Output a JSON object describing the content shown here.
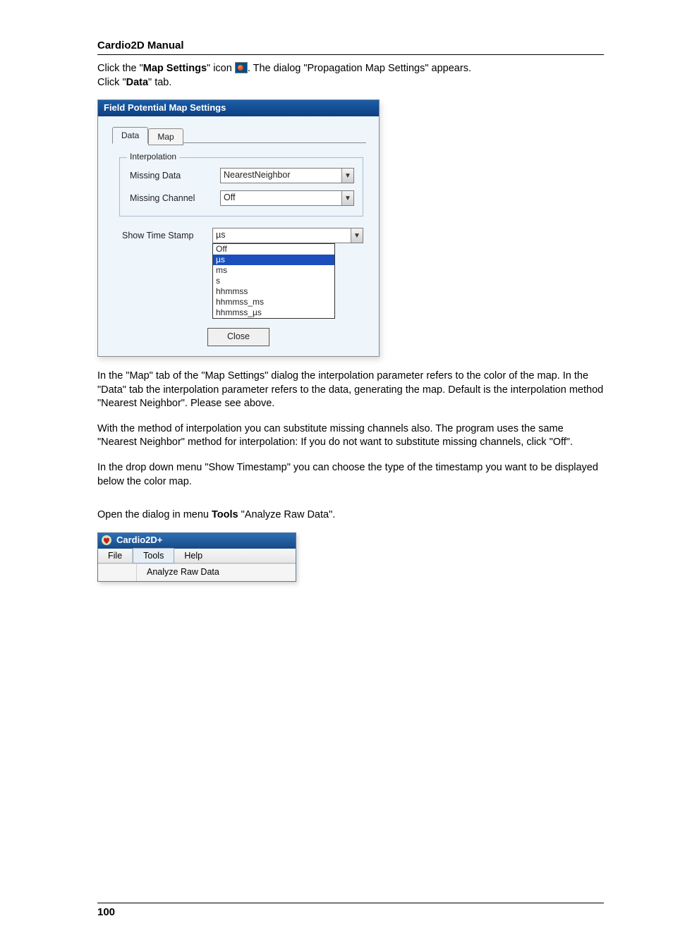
{
  "header": {
    "title": "Cardio2D Manual"
  },
  "intro": {
    "l1a": "Click the \"",
    "l1b": "Map Settings",
    "l1c": "\" icon ",
    "l1d": ". The dialog \"Propagation Map Settings\" appears.",
    "l2a": "Click \"",
    "l2b": "Data",
    "l2c": "\" tab."
  },
  "dialog1": {
    "title": "Field Potential  Map Settings",
    "tabs": {
      "active": "Data",
      "inactive": "Map"
    },
    "fieldset_legend": "Interpolation",
    "rows": {
      "missing_data_label": "Missing Data",
      "missing_data_value": "NearestNeighbor",
      "missing_channel_label": "Missing Channel",
      "missing_channel_value": "Off",
      "show_ts_label": "Show Time Stamp",
      "show_ts_value": "µs"
    },
    "ts_options": [
      "Off",
      "µs",
      "ms",
      "s",
      "hhmmss",
      "hhmmss_ms",
      "hhmmss_µs"
    ],
    "ts_selected_index": 1,
    "close_label": "Close"
  },
  "paras": {
    "p1": "In the \"Map\" tab of the \"Map Settings\" dialog the interpolation parameter refers to the color of the map. In the \"Data\" tab the interpolation parameter refers to the data, generating the map. Default is the interpolation method \"Nearest Neighbor\". Please see above.",
    "p2": "With the method of interpolation you can substitute missing channels also. The program uses the same \"Nearest Neighbor\" method for interpolation: If you do not want to substitute missing channels, click \"Off\".",
    "p3": "In the drop down menu \"Show Timestamp\" you can choose the type of the timestamp you want to be displayed below the color map.",
    "p4a": "Open the dialog in menu ",
    "p4b": "Tools",
    "p4c": " \"Analyze Raw Data\"."
  },
  "appwin": {
    "title": "Cardio2D+",
    "menus": {
      "file": "File",
      "tools": "Tools",
      "help": "Help"
    },
    "menu_item": "Analyze Raw Data"
  },
  "page_number": "100"
}
